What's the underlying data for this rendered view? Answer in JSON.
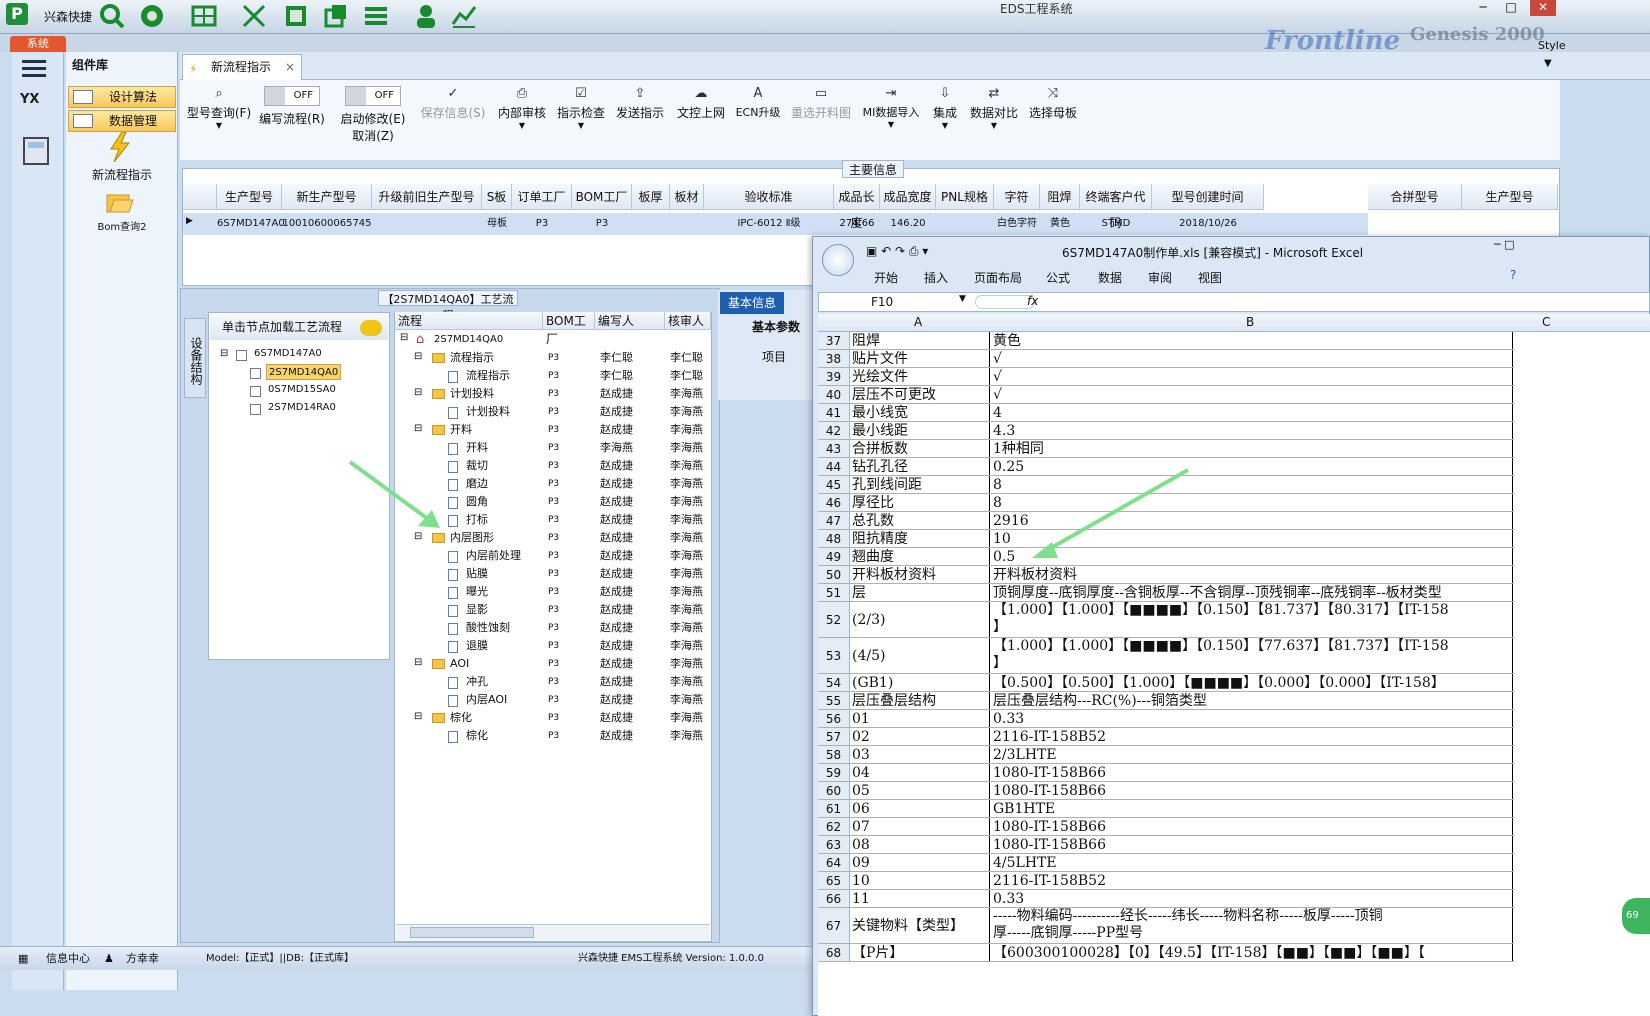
{
  "app": {
    "logo": "P",
    "name": "兴森快捷",
    "window_title": "EDS工程系统",
    "system_tab": "系统",
    "brand": "Frontline",
    "brand2": "Genesis 2000",
    "style_label": "Style"
  },
  "left": {
    "yx": "YX",
    "menu": [
      {
        "label": "设计算法"
      },
      {
        "label": "数据管理"
      }
    ],
    "panel_title": "组件库",
    "items": [
      {
        "label": "新流程指示"
      },
      {
        "label": "Bom查询2"
      }
    ]
  },
  "main_tab": {
    "label": "新流程指示"
  },
  "toolbar": {
    "buttons": [
      {
        "label": "型号查询(F)",
        "icon": "search-icon"
      },
      {
        "label": "编写流程(R)",
        "toggle": "OFF"
      },
      {
        "label": "启动修改(E)",
        "label2": "取消(Z)",
        "toggle": "OFF"
      },
      {
        "label": "保存信息(S)",
        "icon": "check-icon",
        "disabled": true
      },
      {
        "label": "内部审核",
        "icon": "print-icon"
      },
      {
        "label": "指示检查",
        "icon": "checkbox-icon"
      },
      {
        "label": "发送指示",
        "icon": "upload-icon"
      },
      {
        "label": "文控上网",
        "icon": "cloud-icon"
      },
      {
        "label": "ECN升级",
        "icon": "a-icon"
      },
      {
        "label": "重选开料图",
        "icon": "image-icon",
        "disabled": true
      },
      {
        "label": "MI数据导入",
        "icon": "import-icon"
      },
      {
        "label": "集成",
        "icon": "download-icon"
      },
      {
        "label": "数据对比",
        "icon": "compare-icon"
      },
      {
        "label": "选择母板",
        "icon": "shuffle-icon"
      }
    ]
  },
  "main_info": {
    "title": "主要信息",
    "headers": [
      "生产型号",
      "新生产型号",
      "升级前旧生产型号",
      "S板",
      "订单工厂",
      "BOM工厂",
      "板厚",
      "板材",
      "验收标准",
      "成品长度",
      "成品宽度",
      "PNL规格",
      "字符",
      "阻焊",
      "终端客户代码",
      "型号创建时间"
    ],
    "row": [
      "6S7MD147A0",
      "10010600065745",
      "",
      "母板",
      "P3",
      "P3",
      "",
      "",
      "IPC-6012 Ⅱ级",
      "274.66",
      "146.20",
      "",
      "白色字符",
      "黄色",
      "STMD",
      "2018/10/26"
    ],
    "right_headers": [
      "合拼型号",
      "生产型号"
    ]
  },
  "process": {
    "title": "【2S7MD14QA0】工艺流程",
    "side_tab": "设备结构",
    "tree_header": "单击节点加载工艺流程",
    "tree": [
      {
        "label": "6S7MD147A0"
      },
      {
        "label": "2S7MD14QA0"
      },
      {
        "label": "0S7MD15SA0"
      },
      {
        "label": "2S7MD14RA0"
      }
    ],
    "flow_headers": [
      "流程",
      "BOM工厂",
      "编写人",
      "核审人"
    ],
    "flow_root": "2S7MD14QA0",
    "flow": [
      {
        "name": "流程指示",
        "bom": "P3",
        "writer": "李仁聪",
        "reviewer": "李仁聪",
        "lvl": 1,
        "folder": true
      },
      {
        "name": "流程指示",
        "bom": "P3",
        "writer": "李仁聪",
        "reviewer": "李仁聪",
        "lvl": 2
      },
      {
        "name": "计划投料",
        "bom": "P3",
        "writer": "赵成捷",
        "reviewer": "李海燕",
        "lvl": 1,
        "folder": true
      },
      {
        "name": "计划投料",
        "bom": "P3",
        "writer": "赵成捷",
        "reviewer": "李海燕",
        "lvl": 2
      },
      {
        "name": "开料",
        "bom": "P3",
        "writer": "赵成捷",
        "reviewer": "李海燕",
        "lvl": 1,
        "folder": true
      },
      {
        "name": "开料",
        "bom": "P3",
        "writer": "李海燕",
        "reviewer": "李海燕",
        "lvl": 2
      },
      {
        "name": "裁切",
        "bom": "P3",
        "writer": "赵成捷",
        "reviewer": "李海燕",
        "lvl": 2
      },
      {
        "name": "磨边",
        "bom": "P3",
        "writer": "赵成捷",
        "reviewer": "李海燕",
        "lvl": 2
      },
      {
        "name": "圆角",
        "bom": "P3",
        "writer": "赵成捷",
        "reviewer": "李海燕",
        "lvl": 2
      },
      {
        "name": "打标",
        "bom": "P3",
        "writer": "赵成捷",
        "reviewer": "李海燕",
        "lvl": 2
      },
      {
        "name": "内层图形",
        "bom": "P3",
        "writer": "赵成捷",
        "reviewer": "李海燕",
        "lvl": 1,
        "folder": true
      },
      {
        "name": "内层前处理",
        "bom": "P3",
        "writer": "赵成捷",
        "reviewer": "李海燕",
        "lvl": 2
      },
      {
        "name": "贴膜",
        "bom": "P3",
        "writer": "赵成捷",
        "reviewer": "李海燕",
        "lvl": 2
      },
      {
        "name": "曝光",
        "bom": "P3",
        "writer": "赵成捷",
        "reviewer": "李海燕",
        "lvl": 2
      },
      {
        "name": "显影",
        "bom": "P3",
        "writer": "赵成捷",
        "reviewer": "李海燕",
        "lvl": 2
      },
      {
        "name": "酸性蚀刻",
        "bom": "P3",
        "writer": "赵成捷",
        "reviewer": "李海燕",
        "lvl": 2
      },
      {
        "name": "退膜",
        "bom": "P3",
        "writer": "赵成捷",
        "reviewer": "李海燕",
        "lvl": 2
      },
      {
        "name": "AOI",
        "bom": "P3",
        "writer": "赵成捷",
        "reviewer": "李海燕",
        "lvl": 1,
        "folder": true
      },
      {
        "name": "冲孔",
        "bom": "P3",
        "writer": "赵成捷",
        "reviewer": "李海燕",
        "lvl": 2
      },
      {
        "name": "内层AOI",
        "bom": "P3",
        "writer": "赵成捷",
        "reviewer": "李海燕",
        "lvl": 2
      },
      {
        "name": "棕化",
        "bom": "P3",
        "writer": "赵成捷",
        "reviewer": "李海燕",
        "lvl": 1,
        "folder": true
      },
      {
        "name": "棕化",
        "bom": "P3",
        "writer": "赵成捷",
        "reviewer": "李海燕",
        "lvl": 2
      }
    ]
  },
  "basic": {
    "tab": "基本信息",
    "sub": "基本参数",
    "col": "项目"
  },
  "status": {
    "info_center": "信息中心",
    "user": "方幸幸",
    "model": "Model:【正式】||DB:【正式库】",
    "app": "兴森快捷 EMS工程系统 Version: 1.0.0.0"
  },
  "excel": {
    "title": "6S7MD147A0制作单.xls [兼容模式] - Microsoft Excel",
    "tabs": [
      "开始",
      "插入",
      "页面布局",
      "公式",
      "数据",
      "审阅",
      "视图"
    ],
    "namebox": "F10",
    "fx": "fx",
    "cols": [
      "A",
      "B",
      "C"
    ],
    "rows": [
      {
        "n": "37",
        "a": "阻焊",
        "b": "黄色"
      },
      {
        "n": "38",
        "a": "贴片文件",
        "b": "√"
      },
      {
        "n": "39",
        "a": "光绘文件",
        "b": "√"
      },
      {
        "n": "40",
        "a": "层压不可更改",
        "b": "√"
      },
      {
        "n": "41",
        "a": "最小线宽",
        "b": "4"
      },
      {
        "n": "42",
        "a": "最小线距",
        "b": "4.3"
      },
      {
        "n": "43",
        "a": "合拼板数",
        "b": "1种相同"
      },
      {
        "n": "44",
        "a": "钻孔孔径",
        "b": "0.25"
      },
      {
        "n": "45",
        "a": "孔到线间距",
        "b": "8"
      },
      {
        "n": "46",
        "a": "厚径比",
        "b": "8"
      },
      {
        "n": "47",
        "a": "总孔数",
        "b": "2916"
      },
      {
        "n": "48",
        "a": "阻抗精度",
        "b": "10"
      },
      {
        "n": "49",
        "a": "翘曲度",
        "b": "0.5"
      },
      {
        "n": "50",
        "a": "开料板材资料",
        "b": "开料板材资料"
      },
      {
        "n": "51",
        "a": "层",
        "b": "顶铜厚度--底铜厚度--含铜板厚--不含铜厚--顶残铜率--底残铜率--板材类型"
      },
      {
        "n": "52",
        "a": "(2/3)",
        "b": "【1.000】【1.000】【■■■■】【0.150】【81.737】【80.317】【IT-158\n】",
        "h": 36
      },
      {
        "n": "53",
        "a": "(4/5)",
        "b": "【1.000】【1.000】【■■■■】【0.150】【77.637】【81.737】【IT-158\n】",
        "h": 36
      },
      {
        "n": "54",
        "a": "(GB1)",
        "b": "【0.500】【0.500】【1.000】【■■■■】【0.000】【0.000】【IT-158】"
      },
      {
        "n": "55",
        "a": "层压叠层结构",
        "b": "层压叠层结构---RC(%)---铜箔类型"
      },
      {
        "n": "56",
        "a": "01",
        "b": "0.33"
      },
      {
        "n": "57",
        "a": "02",
        "b": "2116-IT-158B52"
      },
      {
        "n": "58",
        "a": "03",
        "b": "2/3LHTE"
      },
      {
        "n": "59",
        "a": "04",
        "b": "1080-IT-158B66"
      },
      {
        "n": "60",
        "a": "05",
        "b": "1080-IT-158B66"
      },
      {
        "n": "61",
        "a": "06",
        "b": "GB1HTE"
      },
      {
        "n": "62",
        "a": "07",
        "b": "1080-IT-158B66"
      },
      {
        "n": "63",
        "a": "08",
        "b": "1080-IT-158B66"
      },
      {
        "n": "64",
        "a": "09",
        "b": "4/5LHTE"
      },
      {
        "n": "65",
        "a": "10",
        "b": "2116-IT-158B52"
      },
      {
        "n": "66",
        "a": "11",
        "b": "0.33"
      },
      {
        "n": "67",
        "a": "关键物料【类型】",
        "b": "-----物料编码----------经长-----纬长-----物料名称-----板厚-----顶铜\n厚-----底铜厚-----PP型号",
        "h": 36
      },
      {
        "n": "68",
        "a": "【P片】",
        "b": "【600300100028】【0】【49.5】【IT-158】【■■】【■■】【■■】【"
      }
    ]
  },
  "colors": {
    "accent": "#1f5fb0",
    "arrow": "#7ee08a"
  }
}
